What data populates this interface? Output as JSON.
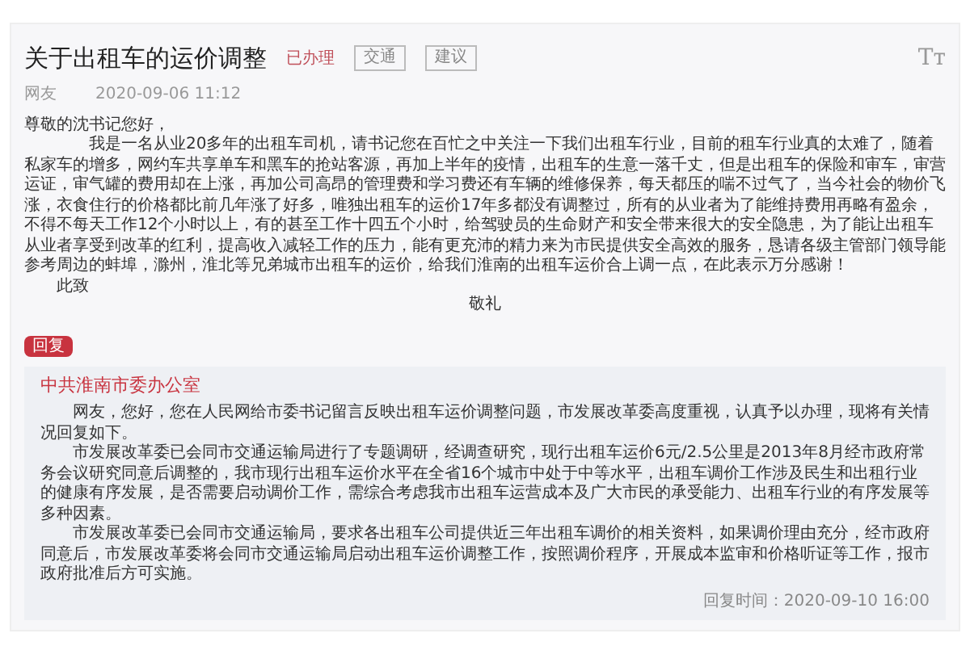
{
  "title": "关于出租车的运价调整",
  "status": "已办理",
  "tags": [
    "交通",
    "建议"
  ],
  "font_toggle": "Tт",
  "author": "网友",
  "date": "2020-09-06 11:12",
  "greeting": "尊敬的沈书记您好，",
  "paragraphs": [
    "我是一名从业20多年的出租车司机，请书记您在百忙之中关注一下我们出租车行业，目前的租车行业真的太难了，随着私家车的增多，网约车共享单车和黑车的抢站客源，再加上半年的疫情，出租车的生意一落千丈，但是出租车的保险和审车，审营运证，审气罐的费用却在上涨，再加公司高昂的管理费和学习费还有车辆的维修保养，每天都压的喘不过气了，当今社会的物价飞涨，衣食住行的价格都比前几年涨了好多，唯独出租车的运价17年多都没有调整过，所有的从业者为了能维持费用再略有盈余，不得不每天工作12个小时以上，有的甚至工作十四五个小时，给驾驶员的生命财产和安全带来很大的安全隐患，为了能让出租车从业者享受到改革的红利，提高收入减轻工作的压力，能有更充沛的精力来为市民提供安全高效的服务，恳请各级主管部门领导能参考周边的蚌埠，滁州，淮北等兄弟城市出租车的运价，给我们淮南的出租车运价合上调一点，在此表示万分感谢！"
  ],
  "closing": "此致",
  "salute": "敬礼",
  "reply": {
    "label": "回复",
    "org": "中共淮南市委办公室",
    "paragraphs": [
      "网友，您好，您在人民网给市委书记留言反映出租车运价调整问题，市发展改革委高度重视，认真予以办理，现将有关情况回复如下。",
      "市发展改革委已会同市交通运输局进行了专题调研，经调查研究，现行出租车运价6元/2.5公里是2013年8月经市政府常务会议研究同意后调整的，我市现行出租车运价水平在全省16个城市中处于中等水平，出租车调价工作涉及民生和出租行业的健康有序发展，是否需要启动调价工作，需综合考虑我市出租车运营成本及广大市民的承受能力、出租车行业的有序发展等多种因素。",
      "市发展改革委已会同市交通运输局，要求各出租车公司提供近三年出租车调价的相关资料，如果调价理由充分，经市政府同意后，市发展改革委将会同市交通运输局启动出租车运价调整工作，按照调价程序，开展成本监审和价格听证等工作，报市政府批准后方可实施。"
    ],
    "time": "回复时间：2020-09-10 16:00"
  }
}
